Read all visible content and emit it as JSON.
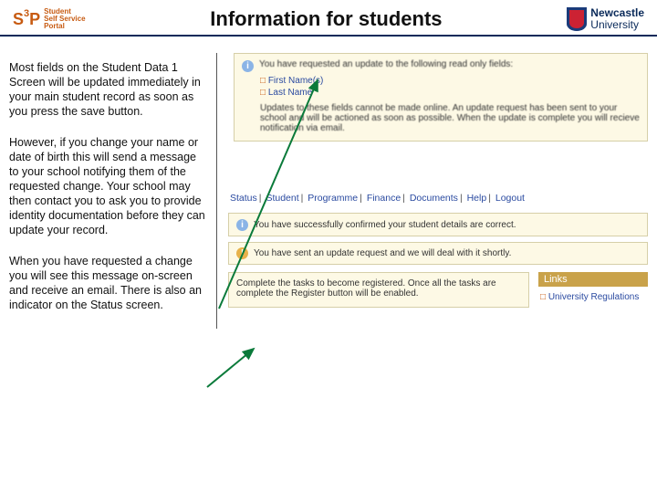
{
  "header": {
    "s3p_line1": "Student",
    "s3p_line2": "Self Service",
    "s3p_line3": "Portal",
    "title": "Information for students",
    "uni_top": "Newcastle",
    "uni_bottom": "University"
  },
  "left": {
    "p1": "Most fields on the Student Data 1 Screen will be updated immediately in your main student record as soon as you press the save button.",
    "p2": "However, if you change your name or date of birth this will send a message to your school notifying them of the requested change. Your school may then contact you to ask you to provide identity documentation before they can update your record.",
    "p3": "When you have requested a change you will see this message on-screen and receive an email. There is also an indicator on the Status screen."
  },
  "msg1": {
    "lead": "You have requested an update to the following read only fields:",
    "item1": "First Name(s)",
    "item2": "Last Name",
    "note": "Updates to these fields cannot be made online. An update request has been sent to your school and will be actioned as soon as possible. When the update is complete you will recieve notification via email."
  },
  "nav": {
    "i1": "Status",
    "i2": "Student",
    "i3": "Programme",
    "i4": "Finance",
    "i5": "Documents",
    "i6": "Help",
    "i7": "Logout"
  },
  "msg2": "You have successfully confirmed your student details are correct.",
  "msg3": "You have sent an update request and we will deal with it shortly.",
  "reg": "Complete the tasks to become registered. Once all the tasks are complete the Register button will be enabled.",
  "links": {
    "hdr": "Links",
    "l1": "University Regulations"
  }
}
